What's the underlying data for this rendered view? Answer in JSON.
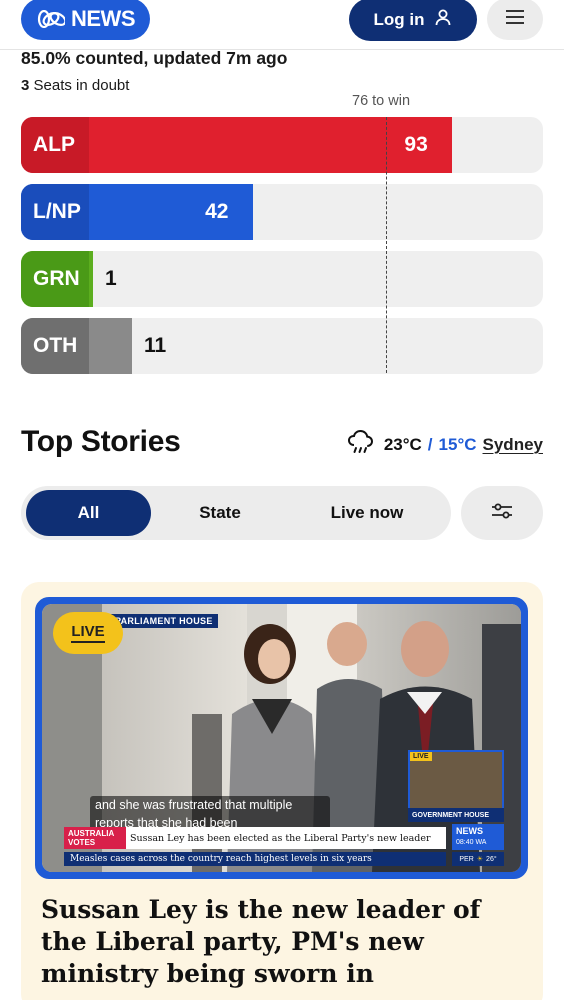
{
  "header": {
    "logo_text": "NEWS",
    "login_label": "Log in",
    "colors": {
      "brand": "#1f5bd6",
      "navy": "#0f2f74"
    }
  },
  "results": {
    "counted_text": "85.0% counted, updated 7m ago",
    "seats_in_doubt_count": "3",
    "seats_in_doubt_label": "Seats in doubt",
    "to_win_label": "76 to win",
    "win_threshold": 76,
    "total_seats": 150,
    "parties": [
      {
        "code": "ALP",
        "seats": "93",
        "seat_count": 93,
        "color": "#e0202e",
        "label_color": "#c81a27"
      },
      {
        "code": "L/NP",
        "seats": "42",
        "seat_count": 42,
        "color": "#1f5bd6",
        "label_color": "#1a4dbb"
      },
      {
        "code": "GRN",
        "seats": "1",
        "seat_count": 1,
        "color": "#5cae1f",
        "label_color": "#4a9a17"
      },
      {
        "code": "OTH",
        "seats": "11",
        "seat_count": 11,
        "color": "#8a8a8a",
        "label_color": "#6f6f6f"
      }
    ]
  },
  "top_stories": {
    "title": "Top Stories",
    "weather": {
      "current": "23°C",
      "separator": "/",
      "low": "15°C",
      "city": "Sydney",
      "icon": "cloud-rain-icon"
    },
    "filters": [
      {
        "label": "All",
        "active": true
      },
      {
        "label": "State",
        "active": false
      },
      {
        "label": "Live now",
        "active": false
      }
    ],
    "settings_icon": "sliders-icon"
  },
  "story": {
    "live_label": "LIVE",
    "headline": "Sussan Ley is the new leader of the Liberal party, PM's new ministry being sworn in",
    "video": {
      "location_tag": "PARLIAMENT HOUSE",
      "caption": "and she was frustrated that multiple reports that she had been",
      "ticker_tag": "AUSTRALIA VOTES",
      "ticker_text": "Sussan Ley has been elected as the Liberal Party's new leader",
      "crawl_text": "Measles cases across the country reach highest levels in six years",
      "pip_live": "LIVE",
      "pip_label": "GOVERNMENT HOUSE",
      "bug_text": "NEWS",
      "bug_time": "08:40 WA",
      "weather_bug": "PER",
      "weather_temp": "26°"
    }
  }
}
